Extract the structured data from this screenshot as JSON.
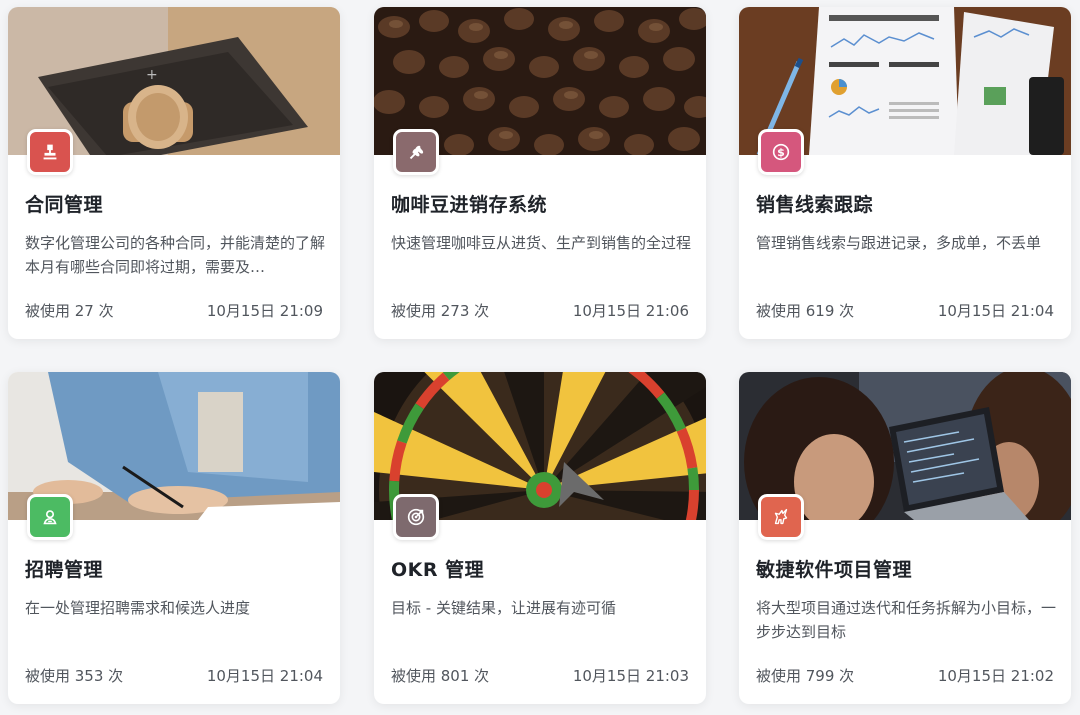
{
  "cards": [
    {
      "title": "合同管理",
      "description": "数字化管理公司的各种合同，并能清楚的了解本月有哪些合同即将过期，需要及…",
      "usage": "被使用 27 次",
      "time": "10月15日 21:09",
      "icon": "stamp-icon",
      "icon_color": "#d9534f",
      "cover": "stamp-photo"
    },
    {
      "title": "咖啡豆进销存系统",
      "description": "快速管理咖啡豆从进货、生产到销售的全过程",
      "usage": "被使用 273 次",
      "time": "10月15日 21:06",
      "icon": "wheat-icon",
      "icon_color": "#8a6a6d",
      "cover": "coffee-beans-photo"
    },
    {
      "title": "销售线索跟踪",
      "description": "管理销售线索与跟进记录，多成单，不丢单",
      "usage": "被使用 619 次",
      "time": "10月15日 21:04",
      "icon": "dollar-coin-icon",
      "icon_color": "#d5577d",
      "cover": "dashboard-report-photo"
    },
    {
      "title": "招聘管理",
      "description": "在一处管理招聘需求和候选人进度",
      "usage": "被使用 353 次",
      "time": "10月15日 21:04",
      "icon": "person-badge-icon",
      "icon_color": "#4cbb63",
      "cover": "writing-hand-photo"
    },
    {
      "title": "OKR 管理",
      "description": "目标 - 关键结果，让进展有迹可循",
      "usage": "被使用 801 次",
      "time": "10月15日 21:03",
      "icon": "target-icon",
      "icon_color": "#7e6a6e",
      "cover": "dartboard-photo"
    },
    {
      "title": "敏捷软件项目管理",
      "description": "将大型项目通过迭代和任务拆解为小目标，一步步达到目标",
      "usage": "被使用 799 次",
      "time": "10月15日 21:02",
      "icon": "unicorn-icon",
      "icon_color": "#e0654f",
      "cover": "laptop-team-photo"
    }
  ]
}
